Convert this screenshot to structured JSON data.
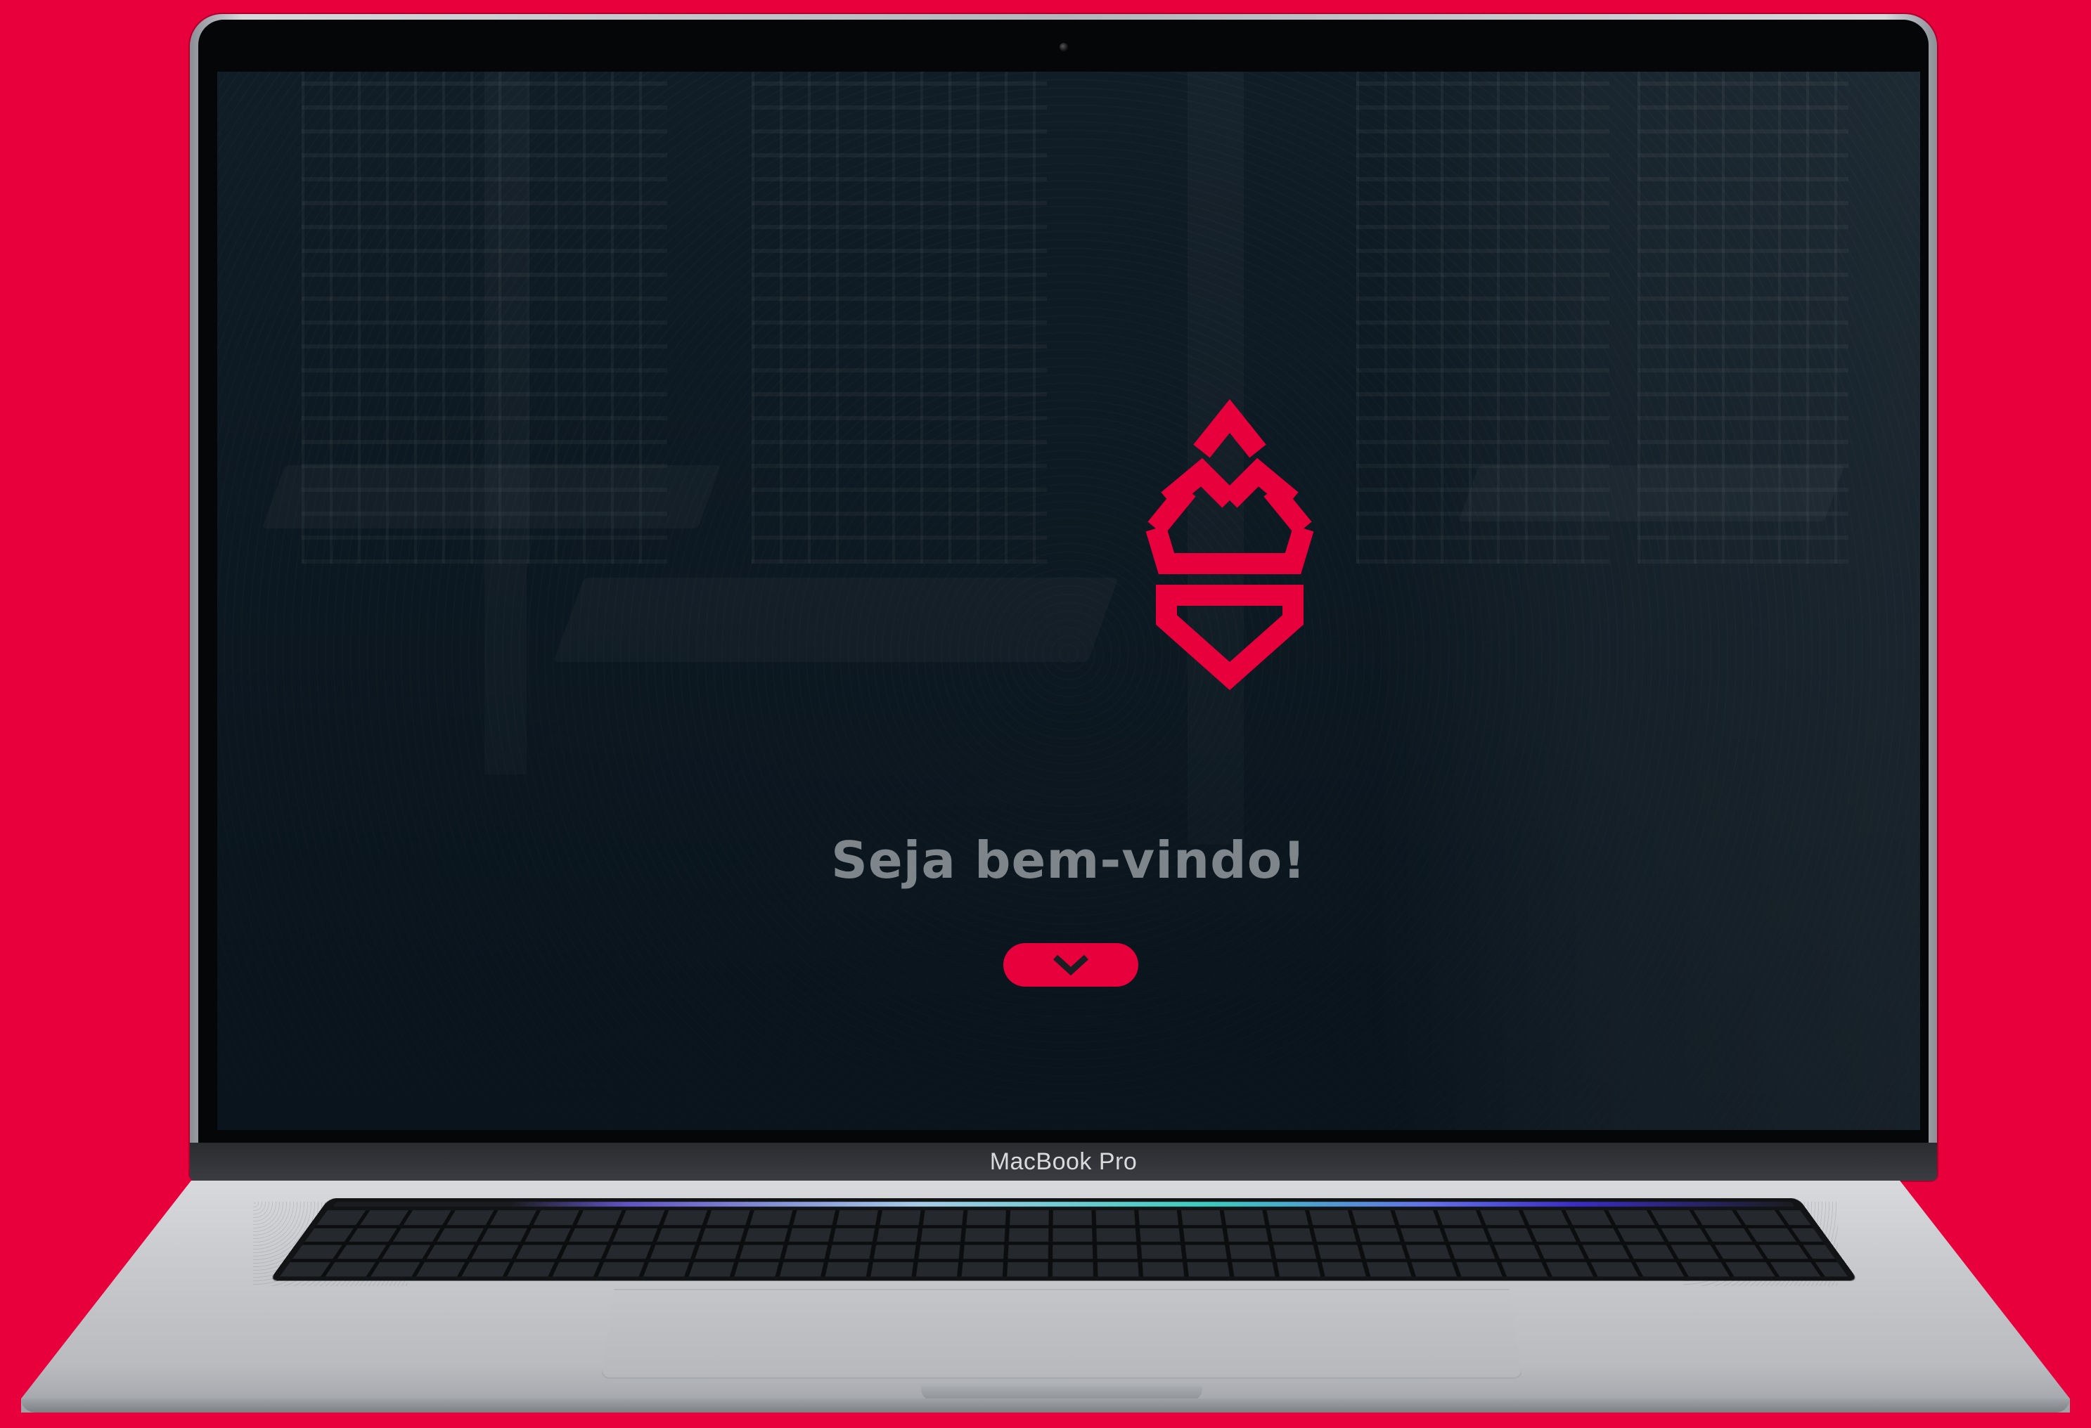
{
  "screen": {
    "welcome_text": "Seja bem-vindo!",
    "scroll_button_icon": "chevron-down-icon",
    "logo_icon": "crown-shield-logo"
  },
  "device": {
    "brand_label": "MacBook Pro"
  },
  "colors": {
    "brand_red": "#e8003d",
    "screen_bg": "#101c25",
    "welcome_text": "#7e858b"
  }
}
